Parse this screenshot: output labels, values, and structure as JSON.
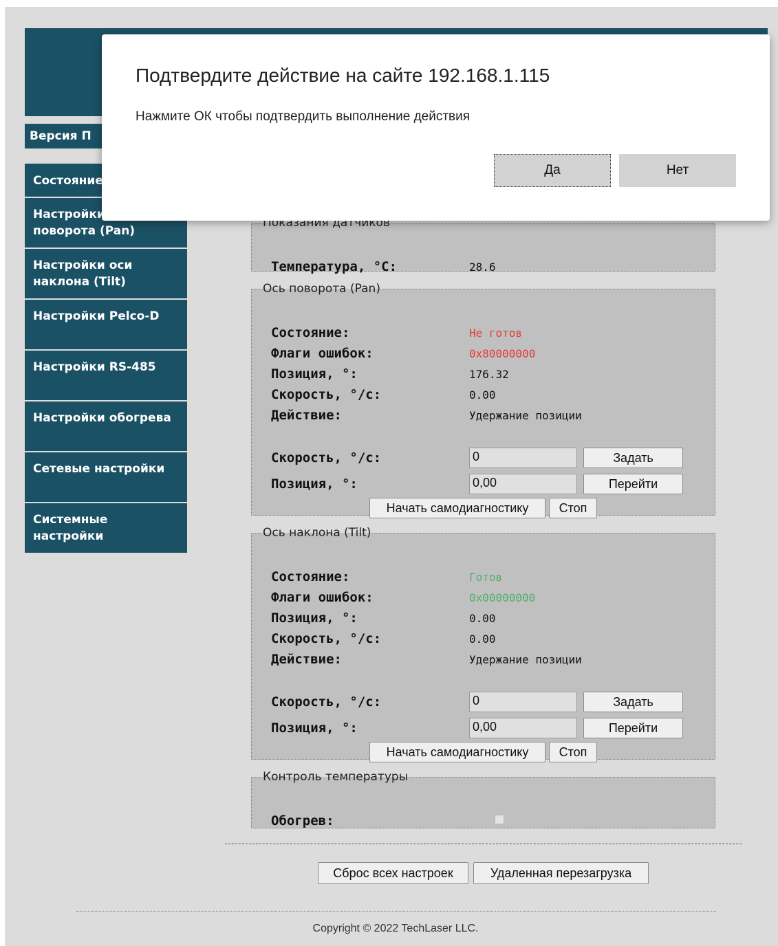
{
  "header": {
    "version_label": "Версия П"
  },
  "sidebar": {
    "items": [
      {
        "label": "Состояние"
      },
      {
        "label": "Настройки оси поворота (Pan)"
      },
      {
        "label": "Настройки оси наклона (Tilt)"
      },
      {
        "label": "Настройки Pelco-D"
      },
      {
        "label": "Настройки RS-485"
      },
      {
        "label": "Настройки обогрева"
      },
      {
        "label": "Сетевые настройки"
      },
      {
        "label": "Системные настройки"
      }
    ]
  },
  "sensors": {
    "legend": "Показания датчиков",
    "temperature_label": "Температура, °C:",
    "temperature_value": "28.6"
  },
  "pan": {
    "legend": "Ось поворота (Pan)",
    "state_label": "Состояние:",
    "state_value": "Не готов",
    "flags_label": "Флаги ошибок:",
    "flags_value": "0x80000000",
    "position_label": "Позиция, °:",
    "position_value": "176.32",
    "speed_label": "Скорость, °/c:",
    "speed_value": "0.00",
    "action_label": "Действие:",
    "action_value": "Удержание позиции",
    "set_speed_label": "Скорость, °/c:",
    "set_speed_input": "0",
    "set_button": "Задать",
    "set_position_label": "Позиция, °:",
    "set_position_input": "0,00",
    "go_button": "Перейти",
    "diag_button": "Начать самодиагностику",
    "stop_button": "Стоп"
  },
  "tilt": {
    "legend": "Ось наклона (Tilt)",
    "state_label": "Состояние:",
    "state_value": "Готов",
    "flags_label": "Флаги ошибок:",
    "flags_value": "0x00000000",
    "position_label": "Позиция, °:",
    "position_value": "0.00",
    "speed_label": "Скорость, °/c:",
    "speed_value": "0.00",
    "action_label": "Действие:",
    "action_value": "Удержание позиции",
    "set_speed_label": "Скорость, °/c:",
    "set_speed_input": "0",
    "set_button": "Задать",
    "set_position_label": "Позиция, °:",
    "set_position_input": "0,00",
    "go_button": "Перейти",
    "diag_button": "Начать самодиагностику",
    "stop_button": "Стоп"
  },
  "temp_control": {
    "legend": "Контроль температуры",
    "heating_label": "Обогрев:",
    "heating_checked": false
  },
  "footer": {
    "reset_button": "Сброс всех настроек",
    "reboot_button": "Удаленная перезагрузка",
    "copyright": "Copyright © 2022 TechLaser LLC."
  },
  "dialog": {
    "title": "Подтвердите действие на сайте 192.168.1.115",
    "message": "Нажмите ОК чтобы подтвердить выполнение действия",
    "yes_button": "Да",
    "no_button": "Нет"
  },
  "colors": {
    "nav_bg": "#1b5164",
    "page_bg": "#dcdcdc",
    "section_bg": "#c0c0c0",
    "error_red": "#e53935",
    "ok_green": "#4caf6d"
  }
}
